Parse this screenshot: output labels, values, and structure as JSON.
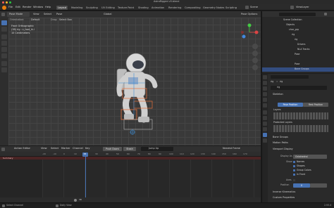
{
  "window": {
    "title": "AstroRigged v5.blend"
  },
  "menubar": {
    "menus": [
      "File",
      "Edit",
      "Render",
      "Window",
      "Help"
    ],
    "workspaces": [
      "Layout",
      "Modeling",
      "Sculpting",
      "UV Editing",
      "Texture Paint",
      "Shading",
      "Animation",
      "Rendering",
      "Compositing",
      "Geometry Nodes",
      "Scripting"
    ],
    "active_workspace": "Layout",
    "scene": "Scene",
    "view_layer": "ViewLayer"
  },
  "viewport": {
    "mode": "Pose Mode",
    "header_menus": [
      "View",
      "Select",
      "Pose"
    ],
    "orientation_label": "Orientation:",
    "orientation": "Default",
    "drag_label": "Drag:",
    "drag": "Select Box",
    "transform": "Global",
    "pose_options": "Pose Options",
    "overlay_info": [
      "Front Orthographic",
      "(38) rig : c_foot_ik.l",
      "10 Centimeters"
    ]
  },
  "action_editor": {
    "editor_label": "Action Editor",
    "menus": [
      "View",
      "Select",
      "Marker",
      "Channel",
      "Key"
    ],
    "push_down": "Push Down",
    "stash": "Stash",
    "action_name": "Jump Up",
    "snap": "Nearest Frame",
    "summary_label": "Summary",
    "frames": [
      "-20",
      "-10",
      "0",
      "10",
      "20",
      "30",
      "40",
      "50",
      "60",
      "70",
      "80",
      "90",
      "100",
      "110",
      "120",
      "130",
      "140",
      "150",
      "160",
      "170",
      "180",
      "190"
    ],
    "current_frame": "38",
    "footer_frame": "38"
  },
  "outliner": {
    "rows": [
      "Scene Collection",
      "Objects",
      "char_grp",
      "rig",
      "rig",
      "Drivers",
      "NLA Tracks",
      "Pose",
      "Astronaut",
      "Pose",
      "Bone Groups"
    ]
  },
  "properties": {
    "breadcrumb": [
      "rig",
      ">",
      "rig"
    ],
    "datablock": "rig",
    "skeleton": {
      "title": "Skeleton",
      "pose_position": "Pose Position",
      "rest_position": "Rest Position",
      "layers_label": "Layers",
      "protected_label": "Protected Layers"
    },
    "collapsed_panels": [
      "Bone Groups",
      "Motion Paths"
    ],
    "viewport_display": {
      "title": "Viewport Display",
      "display_as_label": "Display As",
      "display_as": "Octahedral",
      "show_label": "Show",
      "checks": [
        "Names",
        "Shapes",
        "Group Colors",
        "In Front"
      ],
      "axes_label": "Axes",
      "position_label": "Position",
      "position": "0"
    },
    "bottom_panels": [
      "Inverse Kinematics",
      "Custom Properties"
    ]
  },
  "status": {
    "left": "Select Channel",
    "center": "Dolly View",
    "version": "2.93.4"
  },
  "colors": {
    "accent": "#4772b3",
    "summary": "#4a2424",
    "playhead": "#4772b3",
    "bone_orange": "#e8703a",
    "bone_blue": "#3f8fd6"
  }
}
